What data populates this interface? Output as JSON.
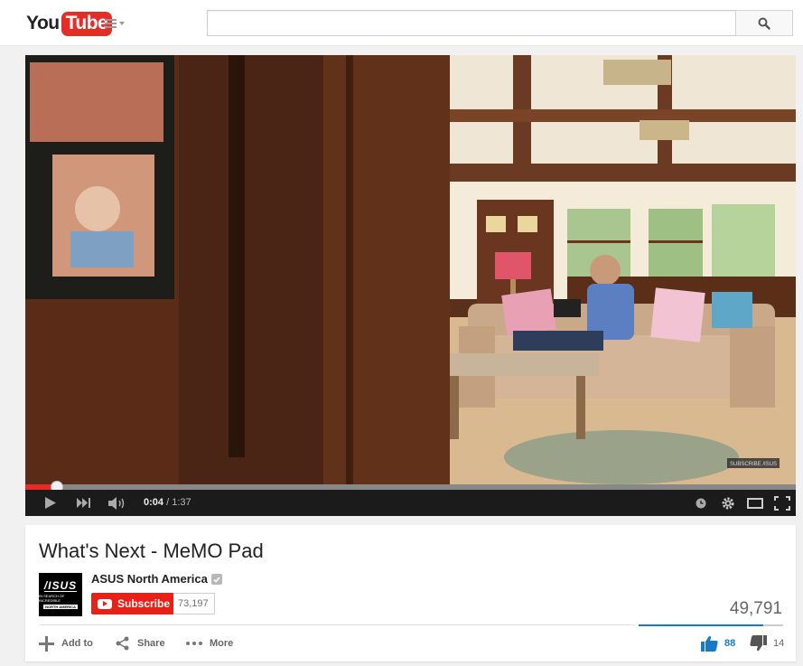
{
  "masthead": {
    "logo_you": "You",
    "logo_tube": "Tube",
    "search_value": "",
    "search_placeholder": ""
  },
  "player": {
    "current_time": "0:04",
    "separator": " / ",
    "duration": "1:37",
    "played_fraction": 0.041,
    "buffered_fraction": 1.0,
    "watermark": "SUBSCRIBE /ISUS"
  },
  "video": {
    "title": "What's Next - MeMO Pad",
    "views": "49,791",
    "like_fraction": 0.863
  },
  "channel": {
    "name": "ASUS North America",
    "avatar_line1": "/ISUS",
    "avatar_line2": "IN SEARCH OF INCREDIBLE",
    "avatar_line3": "NORTH AMERICA",
    "subscribe_label": "Subscribe",
    "subscriber_count": "73,197"
  },
  "actions": {
    "add_to": "Add to",
    "share": "Share",
    "more": "More",
    "likes": "88",
    "dislikes": "14"
  },
  "colors": {
    "brand_red": "#e52d27",
    "like_blue": "#167ac6"
  }
}
